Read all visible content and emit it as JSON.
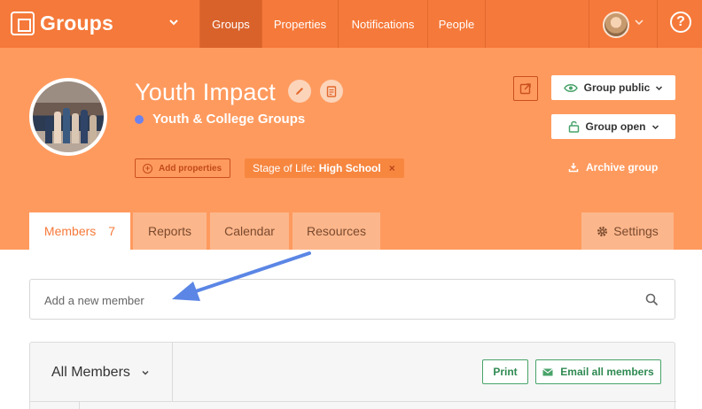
{
  "nav": {
    "app_name": "Groups",
    "tabs": [
      "Groups",
      "Properties",
      "Notifications",
      "People"
    ],
    "active_tab": "Groups",
    "help_label": "?"
  },
  "group": {
    "name": "Youth Impact",
    "category": "Youth & College Groups",
    "category_color": "#6b82ee",
    "add_properties_label": "Add properties",
    "tag_label": "Stage of Life:",
    "tag_value": "High School",
    "tag_remove": "×",
    "public_label": "Group public",
    "open_label": "Group open",
    "archive_label": "Archive group"
  },
  "tabs": {
    "members_label": "Members",
    "members_count": "7",
    "reports_label": "Reports",
    "calendar_label": "Calendar",
    "resources_label": "Resources",
    "settings_label": "Settings"
  },
  "search": {
    "placeholder": "Add a new member"
  },
  "members_panel": {
    "filter_label": "All Members",
    "print_label": "Print",
    "email_label": "Email all members"
  },
  "colors": {
    "nav_bg": "#f5793a",
    "header_bg": "#ff9a5e",
    "accent_green": "#2f8a52",
    "annotation_arrow": "#5b86e5"
  }
}
